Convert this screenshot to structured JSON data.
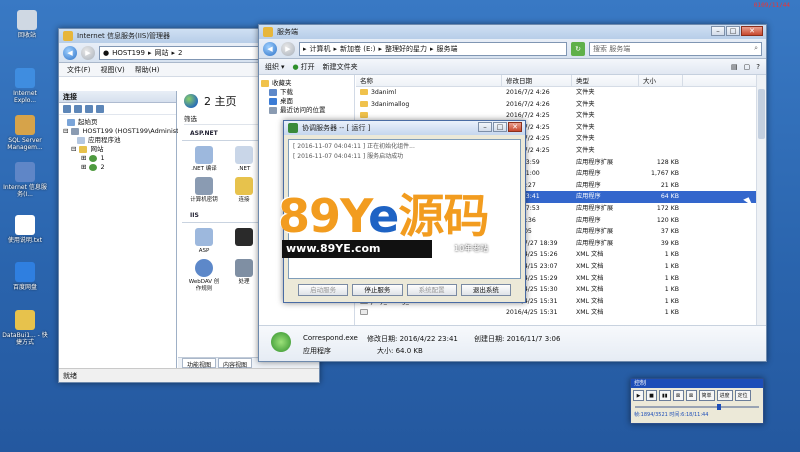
{
  "desktop": {
    "clock_text": "0109/11/44",
    "icons": [
      {
        "label": "回收站",
        "color": "#cfd8e3"
      },
      {
        "label": "Internet Explo...",
        "color": "#3f8de0"
      },
      {
        "label": "SQL Server Managem...",
        "color": "#d6a34a"
      },
      {
        "label": "Internet 信息服务(I...",
        "color": "#5f86c7"
      },
      {
        "label": "使用说明.txt",
        "color": "#ffffff"
      },
      {
        "label": "百度网盘",
        "color": "#2f7fe0"
      },
      {
        "label": "DataBui1... - 快捷方式",
        "color": "#e7c24c"
      }
    ]
  },
  "iis": {
    "title": "Internet 信息服务(IIS)管理器",
    "address_parts": [
      "HOST199",
      "网站",
      "2"
    ],
    "menu": [
      "文件(F)",
      "视图(V)",
      "帮助(H)"
    ],
    "connections_label": "连接",
    "tree": [
      "起始页",
      "HOST199 (HOST199\\Administr",
      "应用程序池",
      "网站",
      "1",
      "2"
    ],
    "main_title": "2 主页",
    "filter_label": "筛选",
    "group_aspnet": "ASP.NET",
    "group_iis": "IIS",
    "features": [
      ".NET 编译",
      ".NET",
      "计算机密钥",
      "连接",
      "ASP",
      "",
      "WebDAV 创作规则",
      "处理"
    ],
    "view_tabs": [
      "功能视图",
      "内容视图"
    ],
    "status": "就绪"
  },
  "explorer": {
    "title": "服务端",
    "address_parts": [
      "计算机",
      "新加卷 (E:)",
      "整理好的星力",
      "服务端"
    ],
    "search_placeholder": "搜索 服务端",
    "toolbar": [
      "组织",
      "打开",
      "新建文件夹"
    ],
    "nav": [
      "收藏夹",
      "下载",
      "桌面",
      "最近访问的位置"
    ],
    "columns": {
      "name": "名称",
      "date": "修改日期",
      "type": "类型",
      "size": "大小"
    },
    "files": [
      {
        "name": "3daniml",
        "date": "2016/7/2 4:26",
        "type": "文件夹",
        "size": "",
        "kind": "folder"
      },
      {
        "name": "3danimallog",
        "date": "2016/7/2 4:26",
        "type": "文件夹",
        "size": "",
        "kind": "folder"
      },
      {
        "name": "",
        "date": "2016/7/2 4:25",
        "type": "文件夹",
        "size": "",
        "kind": "folder"
      },
      {
        "name": "",
        "date": "2016/7/2 4:25",
        "type": "文件夹",
        "size": "",
        "kind": "folder"
      },
      {
        "name": "",
        "date": "2016/7/2 4:25",
        "type": "文件夹",
        "size": "",
        "kind": "folder"
      },
      {
        "name": "",
        "date": "2016/7/2 4:25",
        "type": "文件夹",
        "size": "",
        "kind": "folder"
      },
      {
        "name": "",
        "date": "6/11 13:59",
        "type": "应用程序扩展",
        "size": "128 KB",
        "kind": "app"
      },
      {
        "name": "",
        "date": "6/30 11:00",
        "type": "应用程序",
        "size": "1,767 KB",
        "kind": "app"
      },
      {
        "name": "",
        "date": "6/28 7:27",
        "type": "应用程序",
        "size": "21 KB",
        "kind": "app"
      },
      {
        "name": "",
        "date": "4/22 23:41",
        "type": "应用程序",
        "size": "64 KB",
        "kind": "app",
        "selected": true
      },
      {
        "name": "",
        "date": "6/28 17:53",
        "type": "应用程序扩展",
        "size": "172 KB",
        "kind": "app"
      },
      {
        "name": "",
        "date": "5/5 10:36",
        "type": "应用程序",
        "size": "120 KB",
        "kind": "app"
      },
      {
        "name": "",
        "date": "4/9 0:05",
        "type": "应用程序扩展",
        "size": "37 KB",
        "kind": "app"
      },
      {
        "name": "",
        "date": "2016/7/27 18:39",
        "type": "应用程序扩展",
        "size": "39 KB",
        "kind": "app"
      },
      {
        "name": "",
        "date": "2016/4/25 15:26",
        "type": "XML 文档",
        "size": "1 KB",
        "kind": "xml"
      },
      {
        "name": "",
        "date": "2016/4/15 23:07",
        "type": "XML 文档",
        "size": "1 KB",
        "kind": "xml"
      },
      {
        "name": "",
        "date": "2016/4/25 15:29",
        "type": "XML 文档",
        "size": "1 KB",
        "kind": "xml"
      },
      {
        "name": "jcby_config_385.xml",
        "date": "2016/4/25 15:30",
        "type": "XML 文档",
        "size": "1 KB",
        "kind": "xml"
      },
      {
        "name": "jcby_config_393.xml",
        "date": "2016/4/25 15:31",
        "type": "XML 文档",
        "size": "1 KB",
        "kind": "xml"
      },
      {
        "name": "",
        "date": "2016/4/25 15:31",
        "type": "XML 文档",
        "size": "1 KB",
        "kind": "xml"
      }
    ],
    "details": {
      "name": "Correspond.exe",
      "type": "应用程序",
      "modified_label": "修改日期: 2016/4/22 23:41",
      "size_label": "大小: 64.0 KB",
      "created_label": "创建日期: 2016/11/7 3:06"
    }
  },
  "coordinator": {
    "title": "协调服务器 -- [ 运行 ]",
    "log": [
      "[ 2016-11-07 04:04:11 ] 正在初始化组件...",
      "[ 2016-11-07 04:04:11 ] 服务启动成功"
    ],
    "buttons": [
      {
        "label": "启动服务",
        "disabled": true
      },
      {
        "label": "停止服务",
        "disabled": false
      },
      {
        "label": "系统配置",
        "disabled": true
      },
      {
        "label": "退出系统",
        "disabled": false
      }
    ]
  },
  "watermark": {
    "big_left": "89Y",
    "big_mid": "e",
    "big_right": "源码",
    "url": "www.89YE.com",
    "slogan": "10年老站"
  },
  "control": {
    "title": "控制",
    "buttons": [
      "▶",
      "■",
      "▮▮",
      "⊠",
      "⊠",
      "简单",
      "进度",
      "定位"
    ],
    "slider_fraction": 0.68,
    "status": "帧:1894/3521 时间:6:18/11:44"
  }
}
